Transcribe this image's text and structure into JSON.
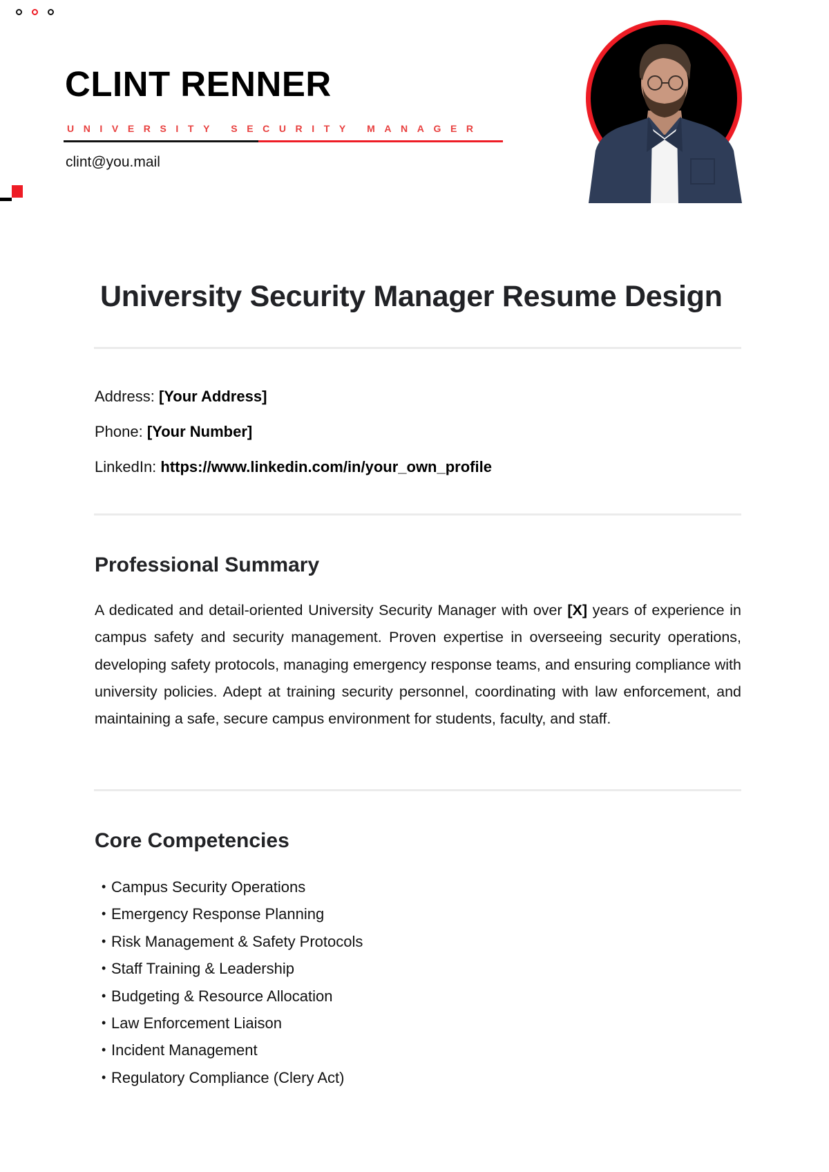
{
  "window": {
    "controls": [
      "dot",
      "dot-red",
      "dot"
    ]
  },
  "header": {
    "name": "CLINT RENNER",
    "role": "UNIVERSITY SECURITY MANAGER",
    "email": "clint@you.mail",
    "photo_alt": "Portrait of Clint Renner"
  },
  "document": {
    "title": "University Security Manager Resume Design",
    "contact": [
      {
        "label": "Address: ",
        "value": "[Your Address]"
      },
      {
        "label": "Phone: ",
        "value": "[Your Number]"
      },
      {
        "label": "LinkedIn: ",
        "value": "https://www.linkedin.com/in/your_own_profile"
      }
    ],
    "summary": {
      "heading": "Professional Summary",
      "text_before": "A dedicated and detail-oriented University Security Manager with over ",
      "highlight": "[X]",
      "text_after": " years of experience in campus safety and security management. Proven expertise in overseeing security operations, developing safety protocols, managing emergency response teams, and ensuring compliance with university policies. Adept at training security personnel, coordinating with law enforcement, and maintaining a safe, secure campus environment for students, faculty, and staff."
    },
    "competencies": {
      "heading": "Core Competencies",
      "bullet": "•",
      "items": [
        "Campus Security Operations",
        "Emergency Response Planning",
        "Risk Management & Safety Protocols",
        "Staff Training & Leadership",
        "Budgeting & Resource Allocation",
        "Law Enforcement Liaison",
        "Incident Management",
        "Regulatory Compliance (Clery Act)"
      ]
    }
  },
  "colors": {
    "accent": "#ee1c25",
    "role_text": "#e8403f",
    "divider": "#ebebeb",
    "heading": "#212226"
  }
}
